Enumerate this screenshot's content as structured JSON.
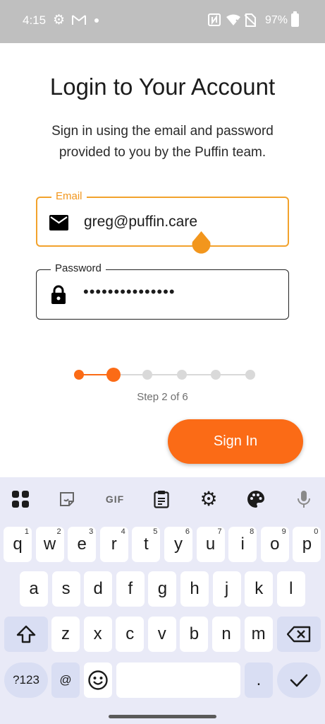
{
  "status_bar": {
    "time": "4:15",
    "battery_percent": "97%",
    "icons": [
      "gear-icon",
      "gmail-icon",
      "notification-dot",
      "nfc-icon",
      "wifi-icon",
      "no-sim-icon",
      "battery-icon"
    ]
  },
  "login": {
    "title": "Login to Your Account",
    "subtitle": "Sign in using the email and password provided to you by the Puffin team.",
    "email": {
      "label": "Email",
      "value": "greg@puffin.care",
      "icon": "mail-icon",
      "state": "focused"
    },
    "password": {
      "label": "Password",
      "value": "•••••••••••••••",
      "icon": "lock-icon"
    },
    "stepper": {
      "current": 2,
      "total": 6,
      "label": "Step 2 of 6"
    },
    "sign_in_label": "Sign In"
  },
  "colors": {
    "accent": "#fb6b16",
    "focus_border": "#f2a22c",
    "status_bar_bg": "#bfbfbf",
    "keyboard_bg": "#e9eaf7",
    "step_inactive": "#d9d9d9"
  },
  "keyboard": {
    "toolbar": [
      "apps-grid-icon",
      "sticker-icon",
      "gif-icon",
      "clipboard-icon",
      "settings-icon",
      "palette-icon",
      "microphone-icon"
    ],
    "gif_label": "GIF",
    "row1": [
      {
        "k": "q",
        "h": "1"
      },
      {
        "k": "w",
        "h": "2"
      },
      {
        "k": "e",
        "h": "3"
      },
      {
        "k": "r",
        "h": "4"
      },
      {
        "k": "t",
        "h": "5"
      },
      {
        "k": "y",
        "h": "6"
      },
      {
        "k": "u",
        "h": "7"
      },
      {
        "k": "i",
        "h": "8"
      },
      {
        "k": "o",
        "h": "9"
      },
      {
        "k": "p",
        "h": "0"
      }
    ],
    "row2": [
      "a",
      "s",
      "d",
      "f",
      "g",
      "h",
      "j",
      "k",
      "l"
    ],
    "row3": [
      "z",
      "x",
      "c",
      "v",
      "b",
      "n",
      "m"
    ],
    "symbols_label": "?123",
    "at_label": "@",
    "period_label": ".",
    "bottom_icons": [
      "shift-icon",
      "backspace-icon",
      "emoji-icon",
      "enter-check-icon"
    ]
  }
}
